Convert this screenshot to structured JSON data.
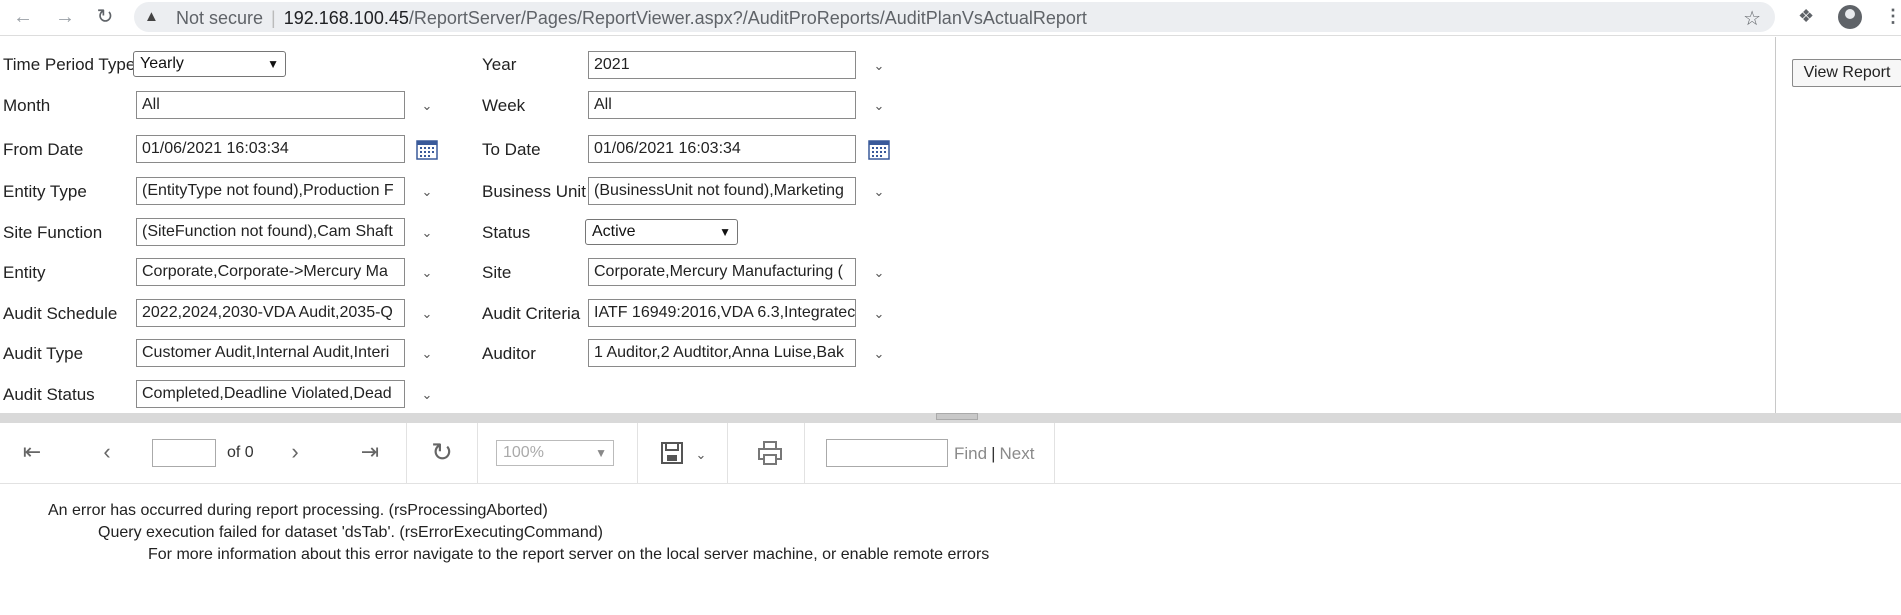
{
  "browser": {
    "security_label": "Not secure",
    "url_host": "192.168.100.45",
    "url_path": "/ReportServer/Pages/ReportViewer.aspx?/AuditProReports/AuditPlanVsActualReport"
  },
  "params": {
    "time_period_type": {
      "label": "Time Period Type",
      "value": "Yearly"
    },
    "year": {
      "label": "Year",
      "value": "2021"
    },
    "month": {
      "label": "Month",
      "value": "All"
    },
    "week": {
      "label": "Week",
      "value": "All"
    },
    "from_date": {
      "label": "From Date",
      "value": "01/06/2021 16:03:34"
    },
    "to_date": {
      "label": "To Date",
      "value": "01/06/2021 16:03:34"
    },
    "entity_type": {
      "label": "Entity Type",
      "value": "(EntityType not found),Production F"
    },
    "business_unit": {
      "label": "Business Unit",
      "value": "(BusinessUnit not found),Marketing"
    },
    "site_function": {
      "label": "Site Function",
      "value": "(SiteFunction not found),Cam Shaft"
    },
    "status": {
      "label": "Status",
      "value": "Active"
    },
    "entity": {
      "label": "Entity",
      "value": "Corporate,Corporate->Mercury Ma"
    },
    "site": {
      "label": "Site",
      "value": "Corporate,Mercury Manufacturing ("
    },
    "audit_schedule": {
      "label": "Audit Schedule",
      "value": "2022,2024,2030-VDA Audit,2035-Q"
    },
    "audit_criteria": {
      "label": "Audit Criteria",
      "value": "IATF 16949:2016,VDA 6.3,Integratec"
    },
    "audit_type": {
      "label": "Audit Type",
      "value": "Customer Audit,Internal Audit,Interi"
    },
    "auditor": {
      "label": "Auditor",
      "value": "1 Auditor,2 Audtitor,Anna Luise,Bak"
    },
    "audit_status": {
      "label": "Audit Status",
      "value": "Completed,Deadline Violated,Dead"
    },
    "view_report_label": "View Report"
  },
  "toolbar": {
    "of_label": "of 0",
    "zoom": "100%",
    "find_label": "Find",
    "divider": "|",
    "next_label": "Next"
  },
  "error": {
    "line1": "An error has occurred during report processing. (rsProcessingAborted)",
    "line2": "Query execution failed for dataset 'dsTab'. (rsErrorExecutingCommand)",
    "line3": "For more information about this error navigate to the report server on the local server machine, or enable remote errors"
  }
}
